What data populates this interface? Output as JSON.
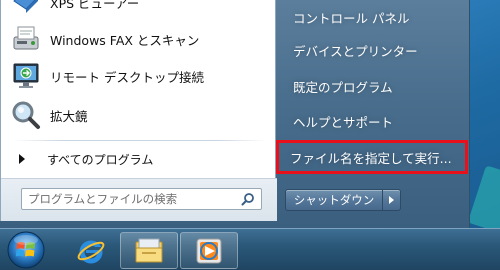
{
  "start_menu": {
    "programs": [
      {
        "label": "XPS ビューアー",
        "icon": "xps-viewer-icon"
      },
      {
        "label": "Windows FAX とスキャン",
        "icon": "fax-scan-icon"
      },
      {
        "label": "リモート デスクトップ接続",
        "icon": "remote-desktop-icon"
      },
      {
        "label": "拡大鏡",
        "icon": "magnifier-icon"
      }
    ],
    "all_programs_label": "すべてのプログラム",
    "search": {
      "placeholder": "プログラムとファイルの検索",
      "value": ""
    },
    "right_items": [
      {
        "label": "コントロール パネル"
      },
      {
        "label": "デバイスとプリンター"
      },
      {
        "label": "既定のプログラム"
      },
      {
        "label": "ヘルプとサポート"
      },
      {
        "label": "ファイル名を指定して実行..."
      }
    ],
    "shutdown_label": "シャットダウン"
  },
  "taskbar": {
    "items": [
      {
        "icon": "start-orb-icon"
      },
      {
        "icon": "internet-explorer-icon"
      },
      {
        "icon": "file-explorer-icon"
      },
      {
        "icon": "media-player-icon"
      }
    ]
  },
  "colors": {
    "highlight_border": "#e8101a",
    "menu_right_bg": "#4a6f8e",
    "taskbar_bg": "#2b5879"
  }
}
